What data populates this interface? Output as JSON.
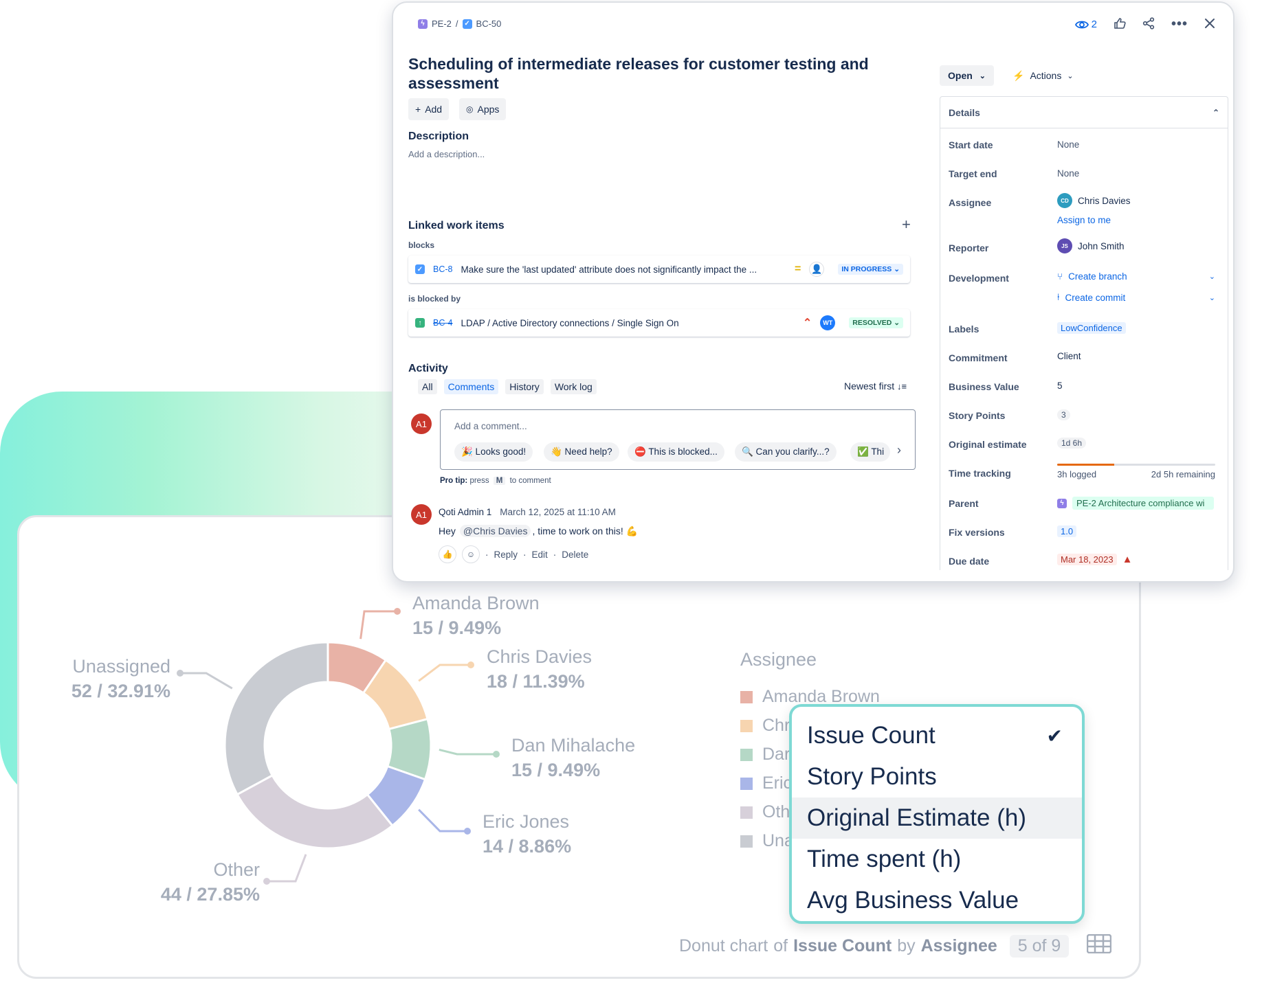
{
  "chart_data": {
    "type": "pie",
    "title": "",
    "subtitle": "",
    "donut": true,
    "legend_title": "Assignee",
    "slices": [
      {
        "name": "Amanda Brown",
        "count": 15,
        "percent": 9.49,
        "label": "15 / 9.49%",
        "color": "#e8b2a6"
      },
      {
        "name": "Chris Davies",
        "count": 18,
        "percent": 11.39,
        "label": "18 / 11.39%",
        "color": "#f7d5b0"
      },
      {
        "name": "Dan Mihalache",
        "count": 15,
        "percent": 9.49,
        "label": "15 / 9.49%",
        "color": "#b5d8c6"
      },
      {
        "name": "Eric Jones",
        "count": 14,
        "percent": 8.86,
        "label": "14 / 8.86%",
        "color": "#a9b6e8"
      },
      {
        "name": "Other",
        "count": 44,
        "percent": 27.85,
        "label": "44 / 27.85%",
        "color": "#d7d0da"
      },
      {
        "name": "Unassigned",
        "count": 52,
        "percent": 32.91,
        "label": "52 / 32.91%",
        "color": "#c9ccd2"
      }
    ],
    "legend": {
      "items": [
        {
          "label": "Amanda Brown",
          "color": "#e8b2a6"
        },
        {
          "label": "Chr",
          "color": "#f7d5b0"
        },
        {
          "label": "Dar",
          "color": "#b5d8c6"
        },
        {
          "label": "Eric",
          "color": "#a9b6e8"
        },
        {
          "label": "Oth",
          "color": "#d7d0da"
        },
        {
          "label": "Una",
          "color": "#c9ccd2"
        }
      ]
    }
  },
  "measure_dropdown": {
    "options": [
      "Issue Count",
      "Story Points",
      "Original Estimate (h)",
      "Time spent (h)",
      "Avg Business Value"
    ],
    "selected": "Issue Count",
    "hovered": "Original Estimate (h)"
  },
  "chart_footer": {
    "prefix": "Donut chart",
    "of": "of",
    "measure": "Issue Count",
    "by": "by",
    "group": "Assignee",
    "pager": "5 of 9",
    "grid_icon": "table-grid-icon"
  },
  "issue": {
    "breadcrumb": {
      "parent_key": "PE-2",
      "separator": "/",
      "key": "BC-50"
    },
    "watchers": "2",
    "title": "Scheduling of intermediate releases for customer testing and assessment",
    "add_label": "Add",
    "apps_label": "Apps",
    "description_heading": "Description",
    "description_placeholder": "Add a description...",
    "linked_heading": "Linked work items",
    "blocks_label": "blocks",
    "blocked_by_label": "is blocked by",
    "links": [
      {
        "key": "BC-8",
        "summary": "Make sure the 'last updated' attribute does not significantly impact the ...",
        "status": "IN PROGRESS"
      },
      {
        "key": "BC-4",
        "summary": "LDAP / Active Directory connections / Single Sign On",
        "status": "RESOLVED",
        "assignee_initials": "WT"
      }
    ],
    "activity": {
      "heading": "Activity",
      "tabs": [
        "All",
        "Comments",
        "History",
        "Work log"
      ],
      "active_tab": "Comments",
      "sort_label": "Newest first",
      "comment_placeholder": "Add a comment...",
      "user_initials": "A1",
      "quick_replies": [
        "🎉 Looks good!",
        "👋 Need help?",
        "⛔ This is blocked...",
        "🔍 Can you clarify...?",
        "✅ Thi"
      ],
      "pro_tip_label": "Pro tip:",
      "pro_tip_press": "press",
      "pro_tip_key": "M",
      "pro_tip_suffix": "to comment",
      "comment": {
        "author": "Qoti Admin 1",
        "date": "March 12, 2025 at 11:10 AM",
        "text_before": "Hey",
        "mention": "@Chris Davies",
        "text_after": ", time to work on this! 💪",
        "reply": "Reply",
        "edit": "Edit",
        "delete": "Delete",
        "dot": "·"
      }
    },
    "status_button": "Open",
    "actions_button": "Actions",
    "details": {
      "heading": "Details",
      "start_date": {
        "label": "Start date",
        "value": "None"
      },
      "target_end": {
        "label": "Target end",
        "value": "None"
      },
      "assignee": {
        "label": "Assignee",
        "initials": "CD",
        "name": "Chris Davies",
        "assign_to_me": "Assign to me"
      },
      "reporter": {
        "label": "Reporter",
        "initials": "JS",
        "name": "John Smith"
      },
      "development": {
        "label": "Development",
        "create_branch": "Create branch",
        "create_commit": "Create commit"
      },
      "labels": {
        "label": "Labels",
        "value": "LowConfidence"
      },
      "commitment": {
        "label": "Commitment",
        "value": "Client"
      },
      "business_value": {
        "label": "Business Value",
        "value": "5"
      },
      "story_points": {
        "label": "Story Points",
        "value": "3"
      },
      "original_estimate": {
        "label": "Original estimate",
        "value": "1d 6h"
      },
      "time_tracking": {
        "label": "Time tracking",
        "logged": "3h logged",
        "remaining": "2d 5h remaining",
        "logged_fraction": 0.36
      },
      "parent": {
        "label": "Parent",
        "value": "PE-2 Architecture compliance wi"
      },
      "fix_versions": {
        "label": "Fix versions",
        "value": "1.0"
      },
      "due_date": {
        "label": "Due date",
        "value": "Mar 18, 2023"
      }
    }
  }
}
